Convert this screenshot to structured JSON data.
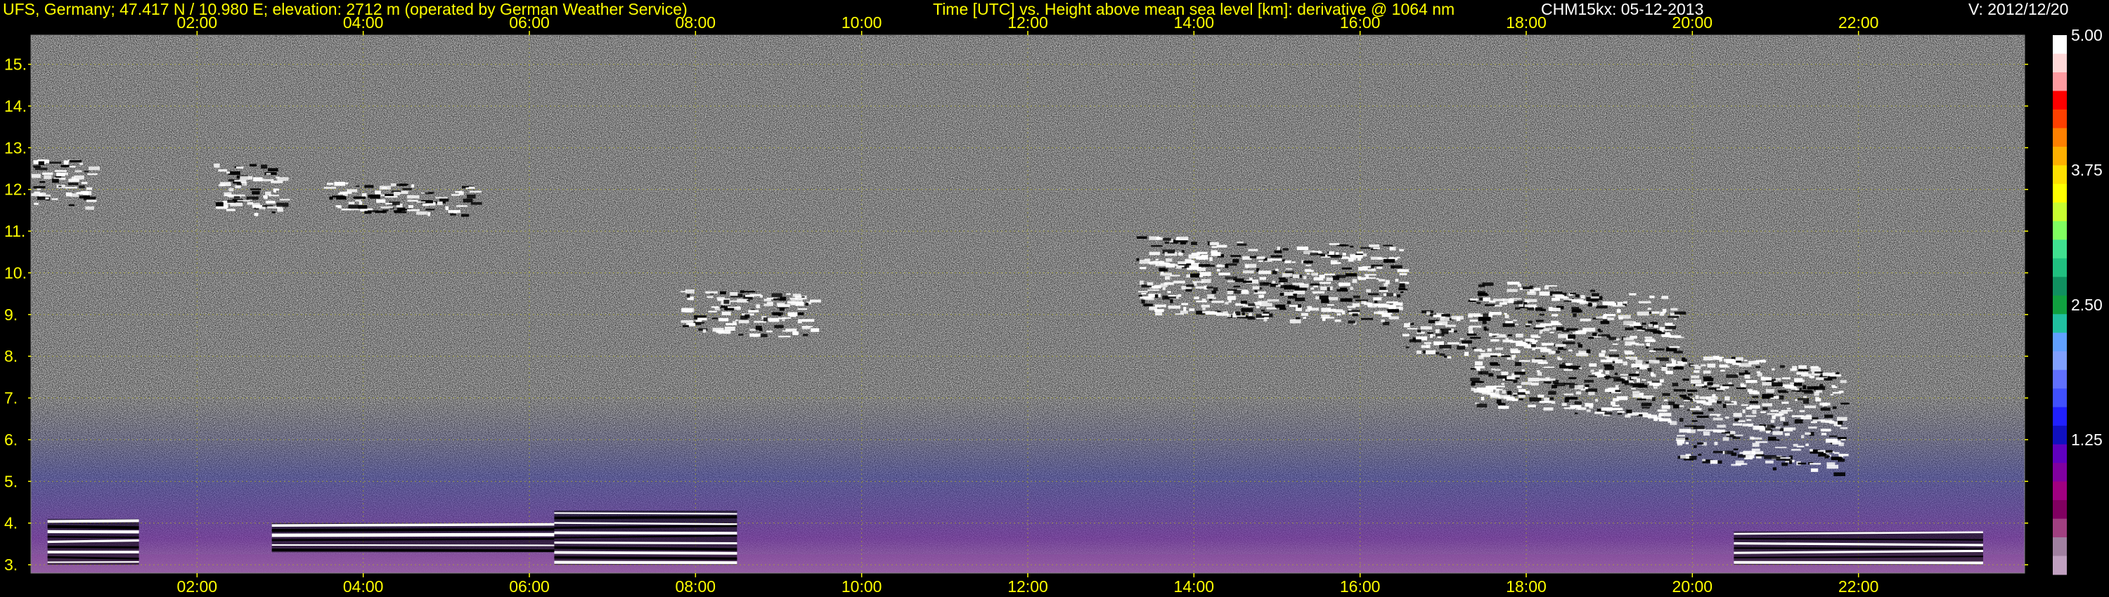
{
  "header": {
    "station": "UFS, Germany; 47.417 N / 10.980 E; elevation: 2712 m  (operated by German Weather Service)",
    "axes_title": "Time [UTC] vs. Height above mean sea level [km]: derivative @ 1064 nm",
    "instrument": "CHM15kx: 05-12-2013",
    "version": "V: 2012/12/20"
  },
  "colors": {
    "axis_text": "#ffff00",
    "header_white": "#ffffff",
    "gridline": "#b0b020",
    "background_noise": "#8a8a8a",
    "aerosol_layer": "#8a4aa0"
  },
  "chart_data": {
    "type": "heatmap",
    "title": "Time [UTC] vs. Height above mean sea level [km]: derivative @ 1064 nm",
    "x": {
      "ticks": [
        "02:00",
        "04:00",
        "06:00",
        "08:00",
        "10:00",
        "12:00",
        "14:00",
        "16:00",
        "18:00",
        "20:00",
        "22:00"
      ],
      "tick_hours": [
        2,
        4,
        6,
        8,
        10,
        12,
        14,
        16,
        18,
        20,
        22
      ],
      "range_hours": [
        0,
        24
      ]
    },
    "y": {
      "ticks": [
        "3.",
        "4.",
        "5.",
        "6.",
        "7.",
        "8.",
        "9.",
        "10.",
        "11.",
        "12.",
        "13.",
        "14.",
        "15."
      ],
      "tick_values": [
        3,
        4,
        5,
        6,
        7,
        8,
        9,
        10,
        11,
        12,
        13,
        14,
        15
      ],
      "range_km": [
        2.8,
        15.7
      ]
    },
    "colorbar": {
      "labels": [
        "5.00",
        "3.75",
        "2.50",
        "1.25"
      ],
      "values": [
        5.0,
        3.75,
        2.5,
        1.25
      ],
      "range": [
        0,
        5.0
      ],
      "colors": [
        "#ffffff",
        "#ffd8d8",
        "#ff9aa0",
        "#ff0000",
        "#ff4000",
        "#ff8000",
        "#ffb000",
        "#ffe000",
        "#ffff00",
        "#c8ff30",
        "#80ff60",
        "#40e090",
        "#20c080",
        "#109060",
        "#10a040",
        "#20c0a0",
        "#60a0ff",
        "#80a0ff",
        "#6070ff",
        "#4050ff",
        "#2020ff",
        "#1010c0",
        "#6000c0",
        "#8000a0",
        "#a00080",
        "#800060",
        "#a04080",
        "#a080a0",
        "#c0a0c0"
      ]
    },
    "grid": true,
    "features": [
      {
        "kind": "cloud",
        "t_start": 0.0,
        "t_end": 0.7,
        "h_low": 11.3,
        "h_high": 13.0
      },
      {
        "kind": "cloud",
        "t_start": 2.2,
        "t_end": 3.0,
        "h_low": 11.2,
        "h_high": 12.9
      },
      {
        "kind": "cloud",
        "t_start": 3.5,
        "t_end": 5.3,
        "h_low": 11.3,
        "h_high": 12.3
      },
      {
        "kind": "cloud",
        "t_start": 7.8,
        "t_end": 9.4,
        "h_low": 8.3,
        "h_high": 9.8
      },
      {
        "kind": "cloud",
        "t_start": 13.3,
        "t_end": 16.5,
        "h_low": 8.5,
        "h_high": 11.2
      },
      {
        "kind": "cloud",
        "t_start": 16.5,
        "t_end": 17.3,
        "h_low": 7.8,
        "h_high": 9.3
      },
      {
        "kind": "cloud",
        "t_start": 17.3,
        "t_end": 19.8,
        "h_low": 6.0,
        "h_high": 10.3
      },
      {
        "kind": "cloud",
        "t_start": 19.8,
        "t_end": 21.8,
        "h_low": 4.8,
        "h_high": 8.5
      },
      {
        "kind": "boundary_layer",
        "t_start": 0.2,
        "t_end": 1.3,
        "h_low": 3.0,
        "h_high": 4.1
      },
      {
        "kind": "boundary_layer",
        "t_start": 2.9,
        "t_end": 6.3,
        "h_low": 3.3,
        "h_high": 4.0
      },
      {
        "kind": "boundary_layer",
        "t_start": 6.3,
        "t_end": 8.5,
        "h_low": 3.0,
        "h_high": 4.3
      },
      {
        "kind": "boundary_layer",
        "t_start": 20.5,
        "t_end": 23.5,
        "h_low": 3.0,
        "h_high": 3.8
      }
    ]
  }
}
